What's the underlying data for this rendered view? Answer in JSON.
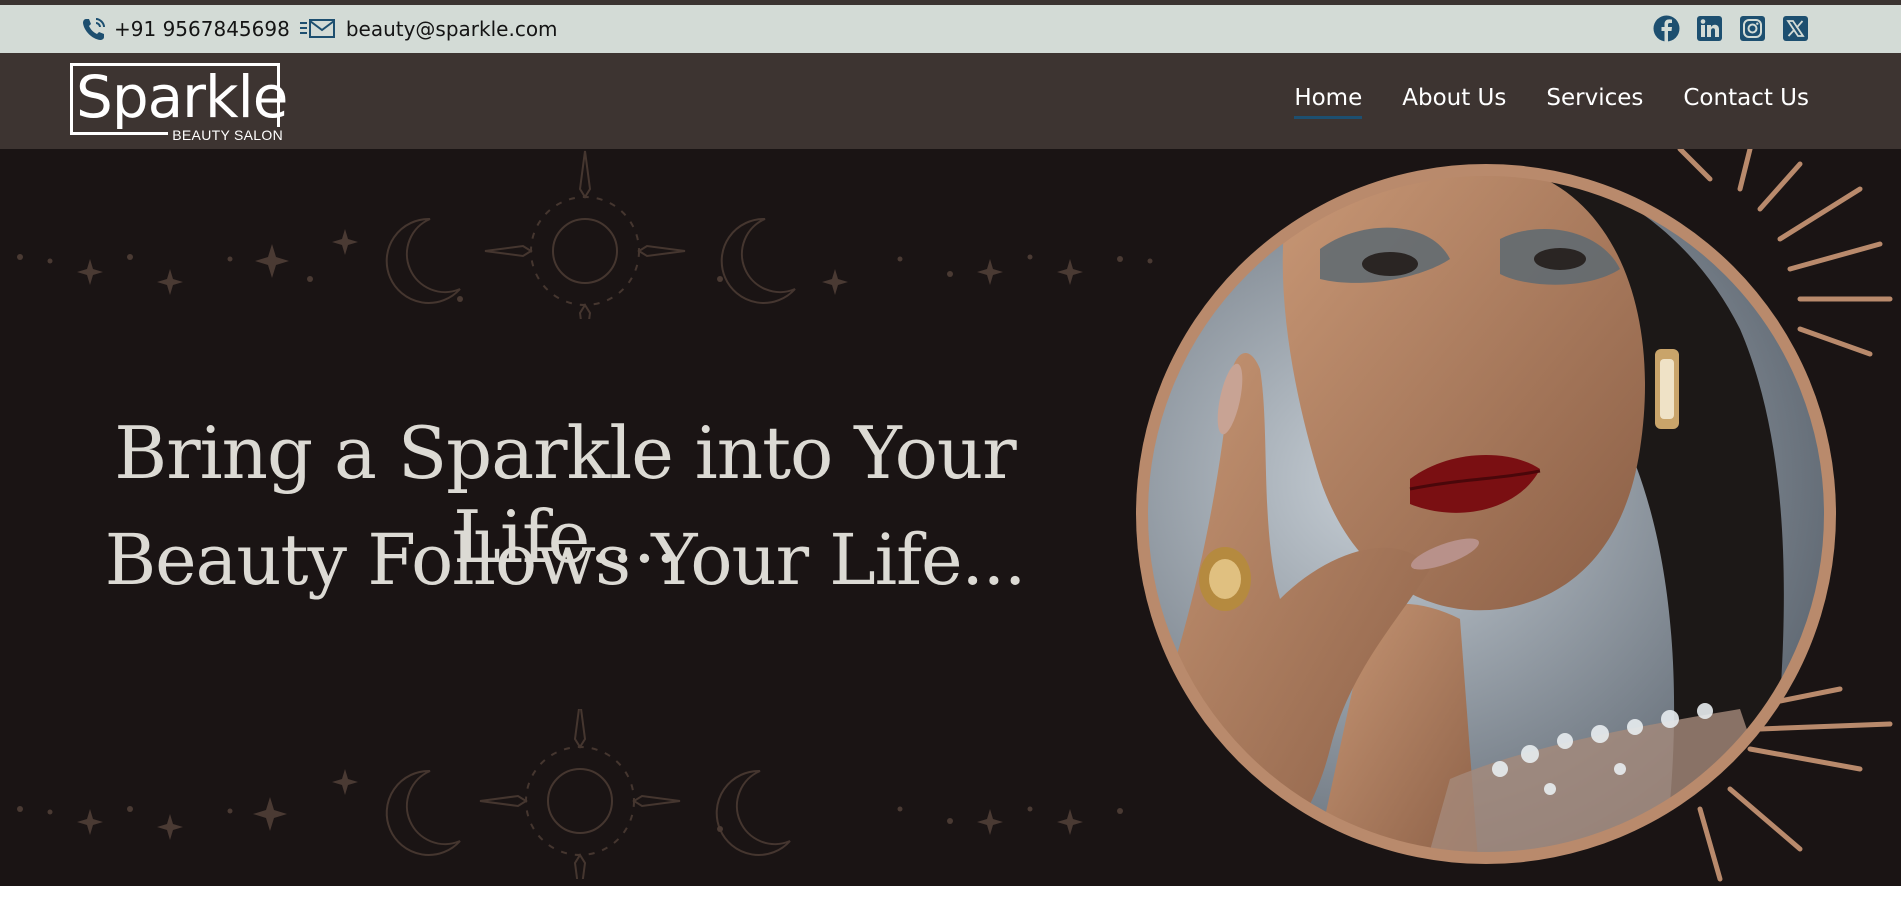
{
  "topbar": {
    "phone": "+91 9567845698",
    "email": "beauty@sparkle.com",
    "social_icons": [
      "facebook-icon",
      "linkedin-icon",
      "instagram-icon",
      "x-twitter-icon"
    ]
  },
  "brand": {
    "name": "Sparkle",
    "tagline": "BEAUTY SALON"
  },
  "nav": {
    "items": [
      {
        "label": "Home",
        "active": true
      },
      {
        "label": "About Us",
        "active": false
      },
      {
        "label": "Services",
        "active": false
      },
      {
        "label": "Contact Us",
        "active": false
      }
    ]
  },
  "hero": {
    "line1": "Bring a Sparkle into Your Life....",
    "line2": "Beauty Follows Your Life..."
  },
  "colors": {
    "topbar_bg": "#d3dbd6",
    "nav_bg": "#3d3431",
    "hero_bg": "#1a1414",
    "accent_copper": "#b98a6c",
    "icon_blue": "#1d4f70",
    "active_underline": "#1d4f70"
  }
}
